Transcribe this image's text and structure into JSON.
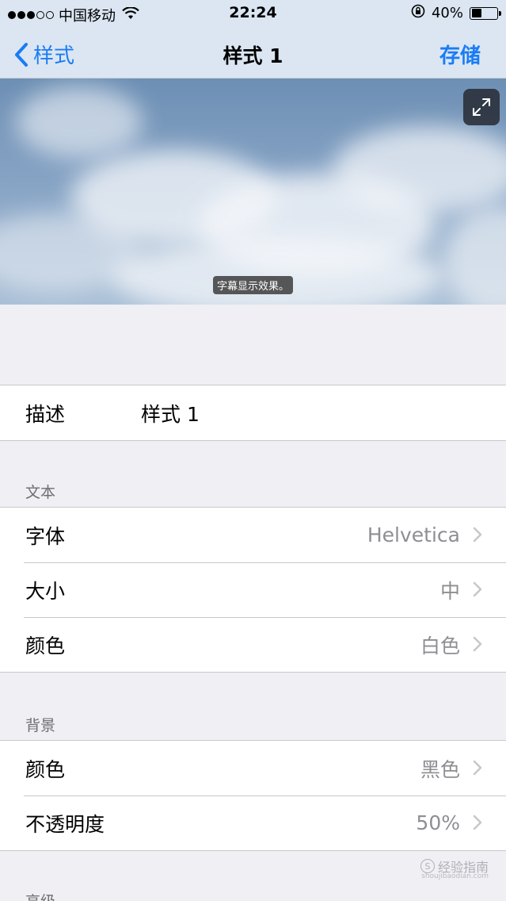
{
  "status_bar": {
    "carrier": "中国移动",
    "time": "22:24",
    "battery_percent": "40%",
    "battery_level": 0.4,
    "signal_filled": 3,
    "signal_total": 5
  },
  "nav": {
    "back_label": "样式",
    "title": "样式 1",
    "save_label": "存储",
    "accent_color": "#1a7cf5"
  },
  "preview": {
    "caption": "字幕显示效果。",
    "expand_icon": "expand-icon"
  },
  "description": {
    "label": "描述",
    "value": "样式 1"
  },
  "text_section": {
    "header": "文本",
    "rows": [
      {
        "label": "字体",
        "value": "Helvetica"
      },
      {
        "label": "大小",
        "value": "中"
      },
      {
        "label": "颜色",
        "value": "白色"
      }
    ]
  },
  "background_section": {
    "header": "背景",
    "rows": [
      {
        "label": "颜色",
        "value": "黑色"
      },
      {
        "label": "不透明度",
        "value": "50%"
      }
    ]
  },
  "advanced_section": {
    "header": "高级"
  },
  "watermark": {
    "text": "经验指南",
    "url": "shoujibaodian.com"
  }
}
